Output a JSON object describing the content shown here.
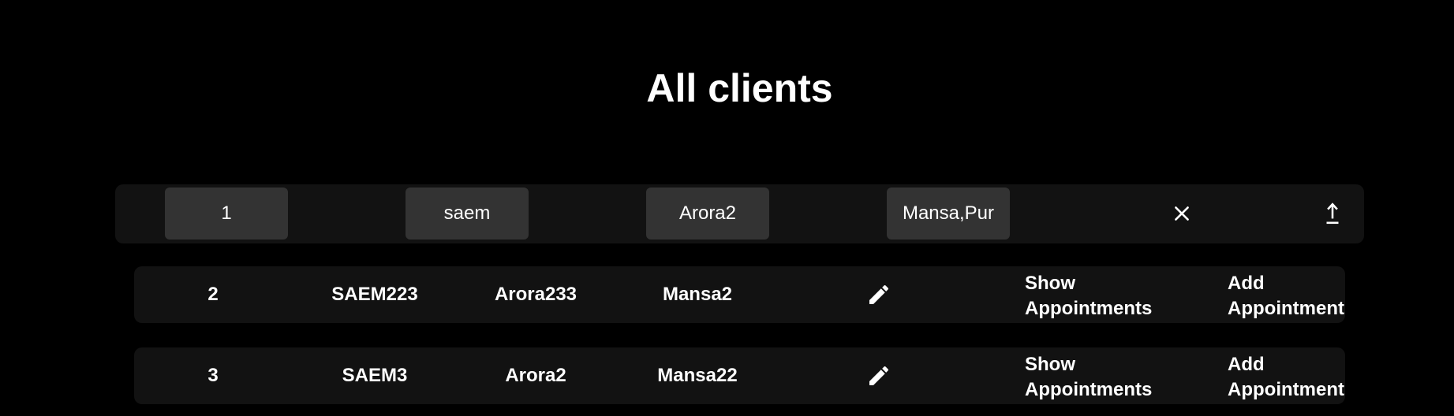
{
  "page": {
    "title": "All clients"
  },
  "edit_bar": {
    "fields": [
      {
        "value": "1"
      },
      {
        "value": "saem"
      },
      {
        "value": "Arora2"
      },
      {
        "value": "Mansa,Pur"
      }
    ],
    "icons": [
      "close-icon",
      "upload-icon"
    ]
  },
  "clients": [
    {
      "id": "2",
      "name": "SAEM223",
      "surname": "Arora233",
      "city": "Mansa2",
      "edit_icon": "pencil-icon",
      "show_label": "Show Appointments",
      "add_label": "Add Appointment"
    },
    {
      "id": "3",
      "name": "SAEM3",
      "surname": "Arora2",
      "city": "Mansa22",
      "edit_icon": "pencil-icon",
      "show_label": "Show Appointments",
      "add_label": "Add Appointment"
    }
  ],
  "colors": {
    "background": "#000000",
    "panel": "#121212",
    "input": "#333333",
    "text": "#ffffff"
  }
}
